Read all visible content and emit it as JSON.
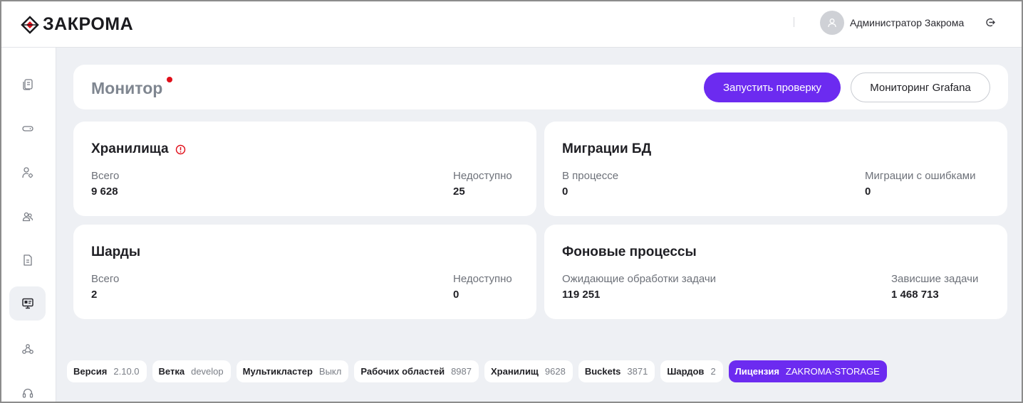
{
  "app": {
    "logo_text": "ЗАКРОМА",
    "user_name": "Администратор Закрома"
  },
  "icons": {
    "logo": "logo-diamond-icon",
    "user": "user-icon",
    "logout": "logout-icon",
    "sidebar": [
      "documents-icon",
      "drive-icon",
      "user-settings-icon",
      "users-icon",
      "file-icon",
      "monitor-icon",
      "network-icon",
      "support-icon"
    ]
  },
  "colors": {
    "accent": "#6c2bf0",
    "alert": "#e00f1a",
    "background": "#eef0f4"
  },
  "monitor": {
    "title": "Монитор",
    "run_check_label": "Запустить проверку",
    "grafana_label": "Мониторинг Grafana"
  },
  "cards": {
    "storages": {
      "title": "Хранилища",
      "left_label": "Всего",
      "left_value": "9 628",
      "right_label": "Недоступно",
      "right_value": "25"
    },
    "migrations": {
      "title": "Миграции БД",
      "left_label": "В процессе",
      "left_value": "0",
      "right_label": "Миграции с ошибками",
      "right_value": "0"
    },
    "shards": {
      "title": "Шарды",
      "left_label": "Всего",
      "left_value": "2",
      "right_label": "Недоступно",
      "right_value": "0"
    },
    "background": {
      "title": "Фоновые процессы",
      "left_label": "Ожидающие обработки задачи",
      "left_value": "119 251",
      "right_label": "Зависшие задачи",
      "right_value": "1 468 713"
    }
  },
  "footer": [
    {
      "key": "Версия",
      "value": "2.10.0"
    },
    {
      "key": "Ветка",
      "value": "develop"
    },
    {
      "key": "Мультикластер",
      "value": "Выкл"
    },
    {
      "key": "Рабочих областей",
      "value": "8987"
    },
    {
      "key": "Хранилищ",
      "value": "9628"
    },
    {
      "key": "Buckets",
      "value": "3871"
    },
    {
      "key": "Шардов",
      "value": "2"
    },
    {
      "key": "Лицензия",
      "value": "ZAKROMA-STORAGE"
    }
  ]
}
